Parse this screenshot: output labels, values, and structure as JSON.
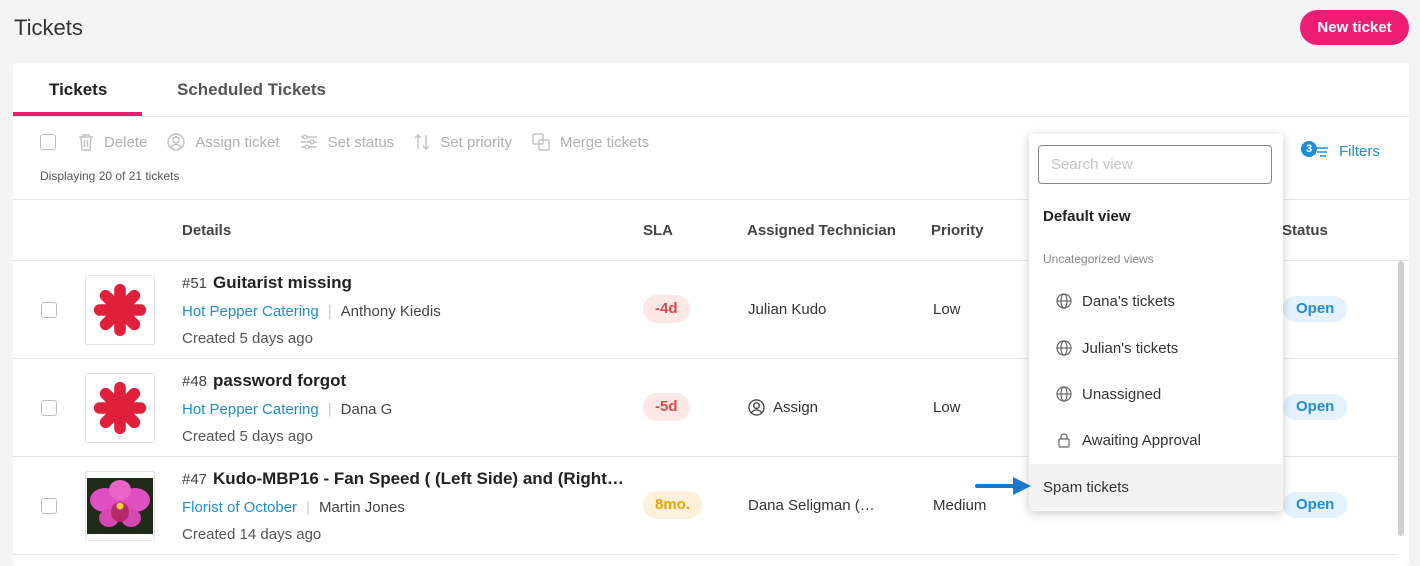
{
  "header": {
    "title": "Tickets",
    "new_ticket_label": "New ticket"
  },
  "tabs": [
    {
      "label": "Tickets",
      "active": true
    },
    {
      "label": "Scheduled Tickets",
      "active": false
    }
  ],
  "toolbar": {
    "delete_label": "Delete",
    "assign_label": "Assign ticket",
    "set_status_label": "Set status",
    "set_priority_label": "Set priority",
    "merge_label": "Merge tickets",
    "displaying": "Displaying 20 of 21 tickets"
  },
  "filters": {
    "label": "Filters",
    "count": "3"
  },
  "columns": {
    "details": "Details",
    "sla": "SLA",
    "technician": "Assigned Technician",
    "priority": "Priority",
    "status": "Status"
  },
  "tickets": [
    {
      "number": "#51",
      "subject": "Guitarist missing",
      "client": "Hot Pepper Catering",
      "contact": "Anthony Kiedis",
      "created": "Created 5 days ago",
      "sla": "-4d",
      "sla_color": "red",
      "technician": "Julian Kudo",
      "priority": "Low",
      "status": "Open",
      "thumb_icon": "red-asterisk-logo"
    },
    {
      "number": "#48",
      "subject": "password forgot",
      "client": "Hot Pepper Catering",
      "contact": "Dana G",
      "created": "Created 5 days ago",
      "sla": "-5d",
      "sla_color": "red",
      "technician": "Assign",
      "priority": "Low",
      "status": "Open",
      "thumb_icon": "red-asterisk-logo"
    },
    {
      "number": "#47",
      "subject": "Kudo-MBP16 - Fan Speed ( (Left Side) and (Right…",
      "client": "Florist of October",
      "contact": "Martin Jones",
      "created": "Created 14 days ago",
      "sla": "8mo.",
      "sla_color": "orange",
      "technician": "Dana Seligman (…",
      "priority": "Medium",
      "status": "Open",
      "thumb_icon": "orchid-photo"
    }
  ],
  "view_dropdown": {
    "search_placeholder": "Search view",
    "default_view": "Default view",
    "group_label": "Uncategorized views",
    "items": [
      {
        "label": "Dana's tickets",
        "icon": "globe-icon"
      },
      {
        "label": "Julian's tickets",
        "icon": "globe-icon"
      },
      {
        "label": "Unassigned",
        "icon": "globe-icon"
      },
      {
        "label": "Awaiting Approval",
        "icon": "lock-icon"
      }
    ],
    "spam_label": "Spam tickets"
  },
  "colors": {
    "accent": "#ee1d74",
    "link": "#1e8fd6"
  }
}
